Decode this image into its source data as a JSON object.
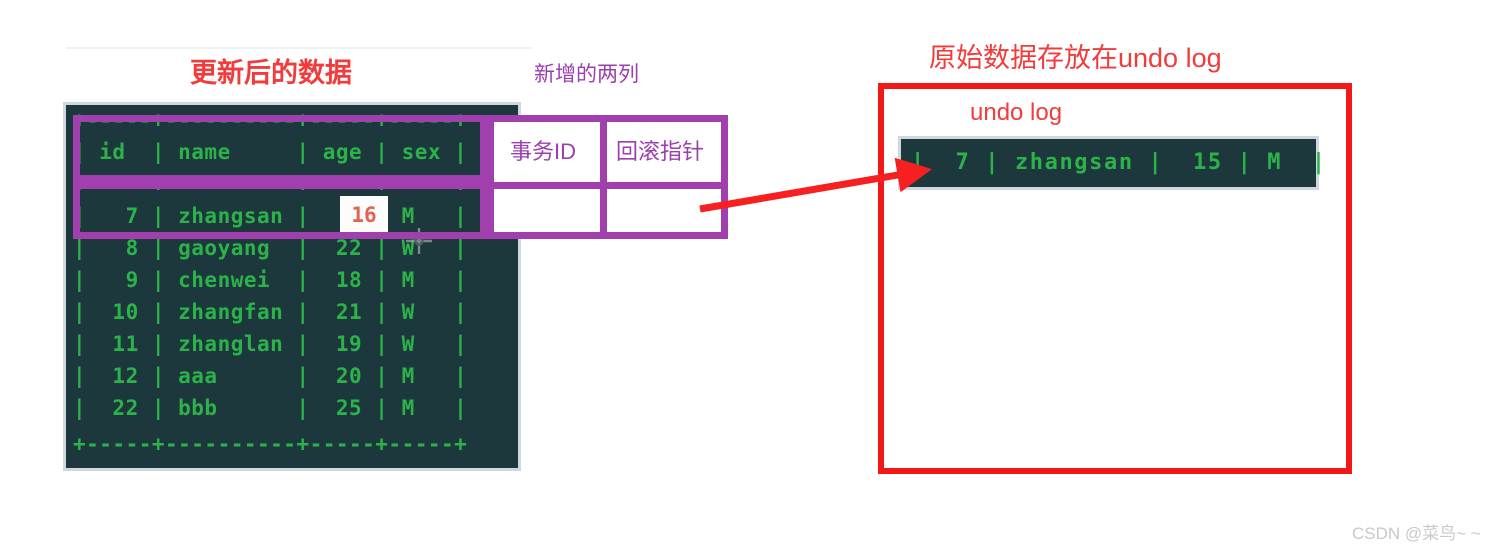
{
  "annotations": {
    "updated_data": "更新后的数据",
    "new_two_columns": "新增的两列",
    "undo_log_title": "原始数据存放在undo log",
    "undo_log_label": "undo log"
  },
  "new_columns": {
    "transaction_id_label": "事务ID",
    "rollback_pointer_label": "回滚指针",
    "transaction_id_value": "",
    "rollback_pointer_value": ""
  },
  "main_table": {
    "columns": [
      "id",
      "name",
      "age",
      "sex"
    ],
    "header_line": "| id  | name     | age | sex |",
    "top_rule": "+-----+----------+-----+-----+",
    "bottom_rule": "+-----+----------+-----+-----+",
    "highlighted_cell": {
      "row_id": "7",
      "column": "age",
      "value": "16"
    },
    "rows": [
      {
        "line": "|   7 | zhangsan |     | M   |",
        "id": "7",
        "name": "zhangsan",
        "age": "16",
        "sex": "M"
      },
      {
        "line": "|   8 | gaoyang  |  22 | W   |",
        "id": "8",
        "name": "gaoyang",
        "age": "22",
        "sex": "W"
      },
      {
        "line": "|   9 | chenwei  |  18 | M   |",
        "id": "9",
        "name": "chenwei",
        "age": "18",
        "sex": "M"
      },
      {
        "line": "|  10 | zhangfan |  21 | W   |",
        "id": "10",
        "name": "zhangfan",
        "age": "21",
        "sex": "W"
      },
      {
        "line": "|  11 | zhanglan |  19 | W   |",
        "id": "11",
        "name": "zhanglan",
        "age": "19",
        "sex": "W"
      },
      {
        "line": "|  12 | aaa      |  20 | M   |",
        "id": "12",
        "name": "aaa",
        "age": "20",
        "sex": "M"
      },
      {
        "line": "|  22 | bbb      |  25 | M   |",
        "id": "22",
        "name": "bbb",
        "age": "25",
        "sex": "M"
      }
    ]
  },
  "undo_log": {
    "row_line": "|  7 | zhangsan |  15 | M  |",
    "row": {
      "id": "7",
      "name": "zhangsan",
      "age": "15",
      "sex": "M"
    }
  },
  "cursor": {
    "icon": "move-crosshair-cursor"
  },
  "watermark": "CSDN @菜鸟~ ~",
  "colors": {
    "terminal_bg": "#1d383c",
    "terminal_text": "#2bb34a",
    "red_accent": "#f21818",
    "red_caption": "#f23b3b",
    "purple_accent": "#a13fae",
    "edited_value": "#e0644f",
    "page_bg": "#ffffff"
  }
}
